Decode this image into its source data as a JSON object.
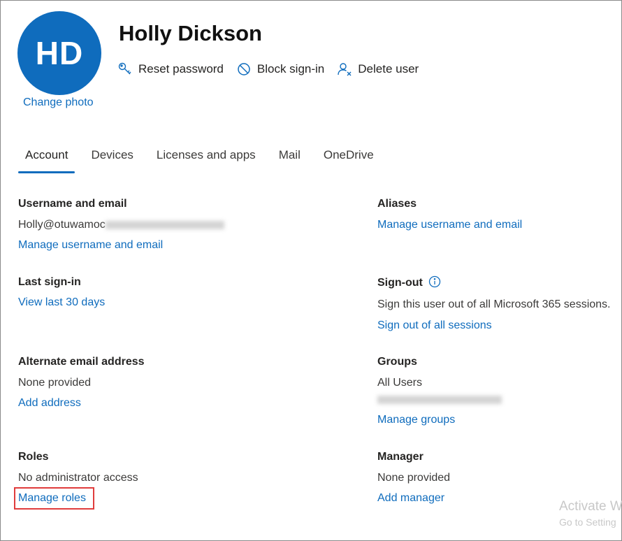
{
  "user": {
    "initials": "HD",
    "name": "Holly Dickson",
    "change_photo": "Change photo"
  },
  "actions": [
    {
      "label": "Reset password",
      "icon": "key-icon"
    },
    {
      "label": "Block sign-in",
      "icon": "block-icon"
    },
    {
      "label": "Delete user",
      "icon": "delete-user-icon"
    }
  ],
  "tabs": [
    {
      "label": "Account",
      "active": true
    },
    {
      "label": "Devices",
      "active": false
    },
    {
      "label": "Licenses and apps",
      "active": false
    },
    {
      "label": "Mail",
      "active": false
    },
    {
      "label": "OneDrive",
      "active": false
    }
  ],
  "sections": {
    "username": {
      "heading": "Username and email",
      "value": "Holly@otuwamoc",
      "link": "Manage username and email"
    },
    "aliases": {
      "heading": "Aliases",
      "link": "Manage username and email"
    },
    "last_signin": {
      "heading": "Last sign-in",
      "link": "View last 30 days"
    },
    "signout": {
      "heading": "Sign-out",
      "text": "Sign this user out of all Microsoft 365 sessions.",
      "link": "Sign out of all sessions"
    },
    "alt_email": {
      "heading": "Alternate email address",
      "value": "None provided",
      "link": "Add address"
    },
    "groups": {
      "heading": "Groups",
      "value": "All Users",
      "link": "Manage groups"
    },
    "roles": {
      "heading": "Roles",
      "value": "No administrator access",
      "link": "Manage roles"
    },
    "manager": {
      "heading": "Manager",
      "value": "None provided",
      "link": "Add manager"
    }
  },
  "watermark": {
    "line1": "Activate W",
    "line2": "Go to Setting"
  },
  "colors": {
    "accent": "#0f6cbd",
    "highlight": "#e03c3c"
  }
}
